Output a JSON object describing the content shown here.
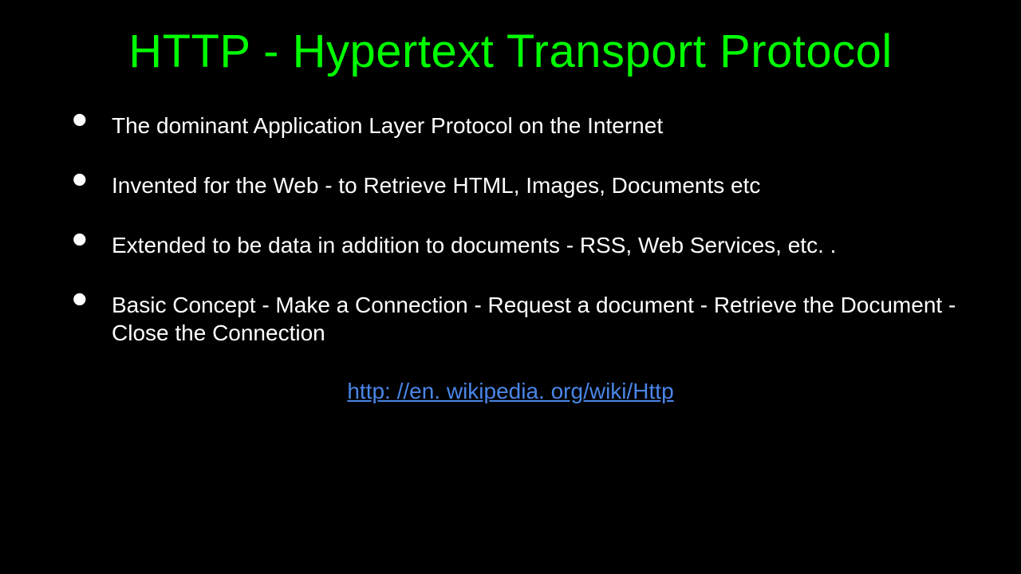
{
  "title": "HTTP - Hypertext Transport Protocol",
  "bullets": [
    "The dominant Application Layer Protocol on the Internet",
    "Invented for the Web - to Retrieve HTML,  Images, Documents etc",
    "Extended to be data in addition to documents - RSS, Web Services, etc. .",
    "Basic Concept - Make a Connection - Request a document - Retrieve the Document - Close the Connection"
  ],
  "link": "http: //en. wikipedia. org/wiki/Http"
}
